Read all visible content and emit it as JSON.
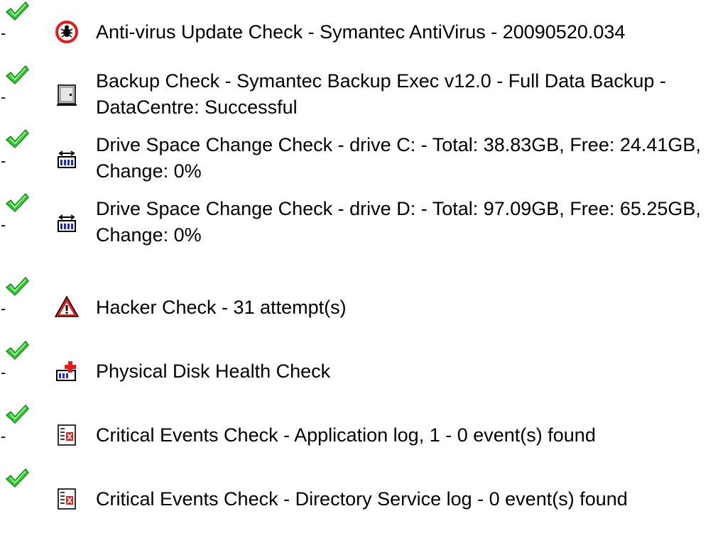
{
  "colors": {
    "check_green": "#33cc33",
    "check_dark": "#1a8f1a",
    "alert_red": "#e21b1b",
    "icon_blue": "#1d2ad3",
    "text": "#000000"
  },
  "checks": [
    {
      "status_icon": "green-check-icon",
      "check_icon": "antivirus-bug-icon",
      "dash": "-",
      "text": "Anti-virus Update Check - Symantec AntiVirus - 20090520.034"
    },
    {
      "status_icon": "green-check-icon",
      "check_icon": "backup-drive-icon",
      "dash": "-",
      "text": "Backup Check - Symantec Backup Exec v12.0 - Full Data Backup - DataCentre: Successful"
    },
    {
      "status_icon": "green-check-icon",
      "check_icon": "drive-space-icon",
      "dash": "-",
      "text": "Drive Space Change Check - drive C: - Total: 38.83GB, Free: 24.41GB, Change: 0%"
    },
    {
      "status_icon": "green-check-icon",
      "check_icon": "drive-space-icon",
      "dash": "-",
      "text": "Drive Space Change Check - drive D: - Total: 97.09GB, Free: 65.25GB, Change: 0%"
    },
    {
      "status_icon": "green-check-icon",
      "check_icon": "hacker-warning-icon",
      "dash": "-",
      "text": "Hacker Check - 31 attempt(s)"
    },
    {
      "status_icon": "green-check-icon",
      "check_icon": "disk-health-icon",
      "dash": "-",
      "text": "Physical Disk Health Check"
    },
    {
      "status_icon": "green-check-icon",
      "check_icon": "event-log-icon",
      "dash": "-",
      "text": "Critical Events Check - Application log, 1 - 0 event(s) found"
    },
    {
      "status_icon": "green-check-icon",
      "check_icon": "event-log-icon",
      "dash": "",
      "text": "Critical Events Check - Directory Service log - 0 event(s) found"
    }
  ]
}
